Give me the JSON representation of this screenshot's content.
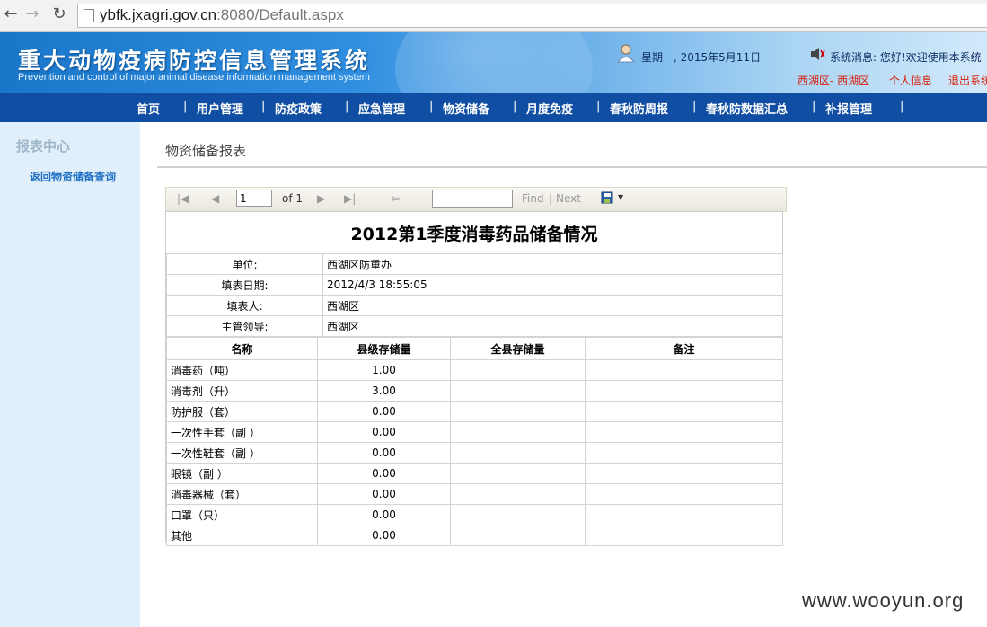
{
  "browser": {
    "url_host": "ybfk.jxagri.gov.cn",
    "url_rest": ":8080/Default.aspx"
  },
  "header": {
    "title": "重大动物疫病防控信息管理系统",
    "subtitle": "Prevention and control of major animal disease information management system",
    "date": "星期一, 2015年5月11日",
    "message": "系统消息: 您好!欢迎使用本系统",
    "region": "西湖区- 西湖区",
    "personal_info": "个人信息",
    "logout": "退出系统"
  },
  "nav": {
    "items": [
      "首页",
      "用户管理",
      "防疫政策",
      "应急管理",
      "物资储备",
      "月度免疫",
      "春秋防周报",
      "春秋防数据汇总",
      "补报管理"
    ]
  },
  "sidebar": {
    "title": "报表中心",
    "link": "返回物资储备查询"
  },
  "content": {
    "title": "物资储备报表"
  },
  "toolbar": {
    "page_value": "1",
    "of_label": "of 1",
    "find_label": "Find",
    "separator": "|",
    "next_label": "Next"
  },
  "report": {
    "title": "2012第1季度消毒药品储备情况",
    "info": [
      {
        "label": "单位:",
        "value": "西湖区防重办"
      },
      {
        "label": "填表日期:",
        "value": "2012/4/3 18:55:05"
      },
      {
        "label": "填表人:",
        "value": "西湖区"
      },
      {
        "label": "主管领导:",
        "value": "西湖区"
      }
    ],
    "columns": [
      "名称",
      "县级存储量",
      "全县存储量",
      "备注"
    ],
    "rows": [
      {
        "name": "消毒药（吨）",
        "county": "1.00"
      },
      {
        "name": "消毒剂（升）",
        "county": "3.00"
      },
      {
        "name": "防护服（套）",
        "county": "0.00"
      },
      {
        "name": "一次性手套（副 ）",
        "county": "0.00"
      },
      {
        "name": "一次性鞋套（副 ）",
        "county": "0.00"
      },
      {
        "name": "眼镜（副 ）",
        "county": "0.00"
      },
      {
        "name": "消毒器械（套）",
        "county": "0.00"
      },
      {
        "name": "口罩（只）",
        "county": "0.00"
      },
      {
        "name": "其他",
        "county": "0.00"
      }
    ]
  },
  "watermark": "www.wooyun.org"
}
